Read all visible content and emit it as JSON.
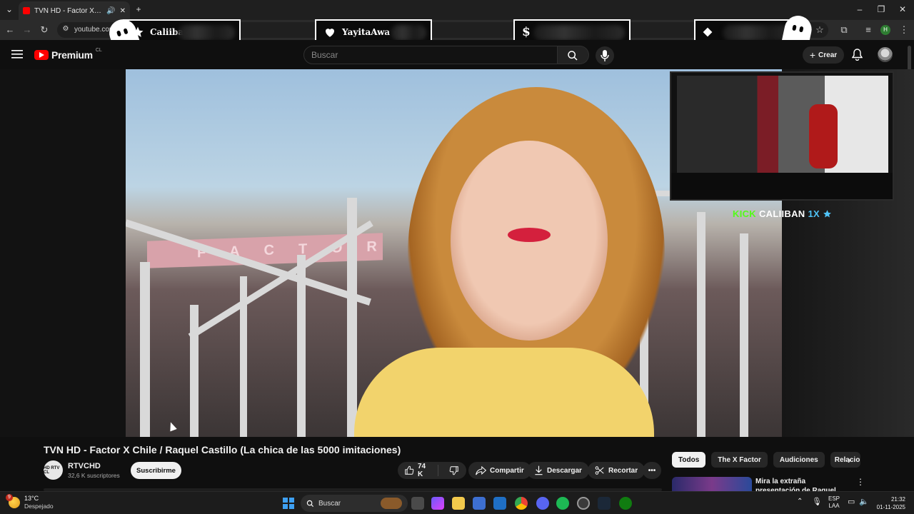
{
  "browser": {
    "tab_title": "TVN HD - Factor X Chile / R",
    "url": "youtube.com"
  },
  "overlay": {
    "boxes": [
      {
        "icon": "star",
        "name": "Caliiban"
      },
      {
        "icon": "heart",
        "name": "YayitaAwa"
      },
      {
        "icon": "dollar",
        "name": ""
      },
      {
        "icon": "diamond",
        "name": ""
      }
    ],
    "dollar_glyph": "$",
    "kick_label": "KICK",
    "kick_name": "CALIIBAN",
    "kick_mult": "1X"
  },
  "youtube": {
    "brand": "Premium",
    "country": "CL",
    "search_placeholder": "Buscar",
    "create_label": "Crear"
  },
  "video": {
    "banner_text": "FACTOR",
    "title": "TVN HD - Factor X Chile / Raquel Castillo (La chica de las 5000 imitaciones)",
    "channel": "RTVCHD",
    "channel_avatar_text": "HD RTV CL",
    "subscribers": "32,6 K suscriptores",
    "subscribe_label": "Suscribirme",
    "likes": "74 K",
    "share_label": "Compartir",
    "download_label": "Descargar",
    "clip_label": "Recortar"
  },
  "sidebar": {
    "chips": [
      "Todos",
      "The X Factor",
      "Audiciones",
      "Relacion"
    ],
    "recommended_title": "Mira la extraña presentación de Raquel Castillo - TALENTO"
  },
  "taskbar": {
    "temperature": "13°C",
    "weather_desc": "Despejado",
    "weather_badge": "9",
    "search_label": "Buscar",
    "lang_top": "ESP",
    "lang_bottom": "LAA",
    "time": "21:32",
    "date": "01-11-2025"
  },
  "colors": {
    "kick_green": "#53fc18",
    "youtube_red": "#ff0000",
    "star_blue": "#4fc3f7"
  }
}
